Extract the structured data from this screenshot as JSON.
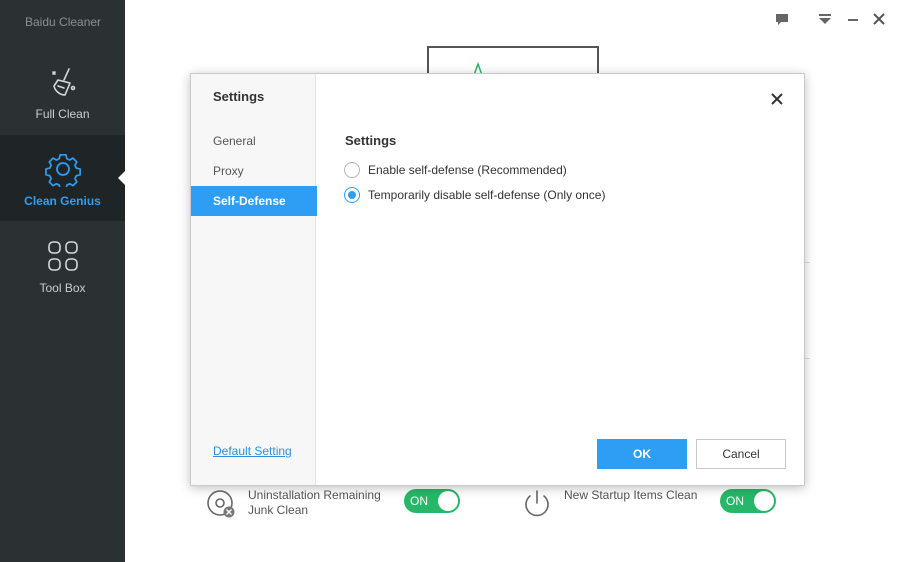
{
  "app": {
    "title": "Baidu Cleaner"
  },
  "sidebar": {
    "items": [
      {
        "label": "Full Clean",
        "icon": "broom-icon",
        "active": false
      },
      {
        "label": "Clean Genius",
        "icon": "gear-icon",
        "active": true
      },
      {
        "label": "Tool Box",
        "icon": "grid-icon",
        "active": false
      }
    ]
  },
  "window_controls": [
    "feedback-icon",
    "menu-icon",
    "minimize-icon",
    "close-icon"
  ],
  "features": [
    {
      "label": "Uninstallation Remaining Junk Clean",
      "toggle": "ON",
      "icon": "uninstall-disc-icon"
    },
    {
      "label": "New Startup Items Clean",
      "toggle": "ON",
      "icon": "power-icon"
    }
  ],
  "dialog": {
    "side_title": "Settings",
    "nav": [
      "General",
      "Proxy",
      "Self-Defense"
    ],
    "active_nav": "Self-Defense",
    "default_link": "Default Setting",
    "section_title": "Settings",
    "options": [
      {
        "label": "Enable self-defense (Recommended)",
        "checked": false
      },
      {
        "label": "Temporarily disable self-defense (Only once)",
        "checked": true
      }
    ],
    "ok_label": "OK",
    "cancel_label": "Cancel"
  },
  "colors": {
    "accent": "#2e9ef4",
    "sidebar_bg": "#2b3033",
    "toggle_on": "#27b768"
  }
}
